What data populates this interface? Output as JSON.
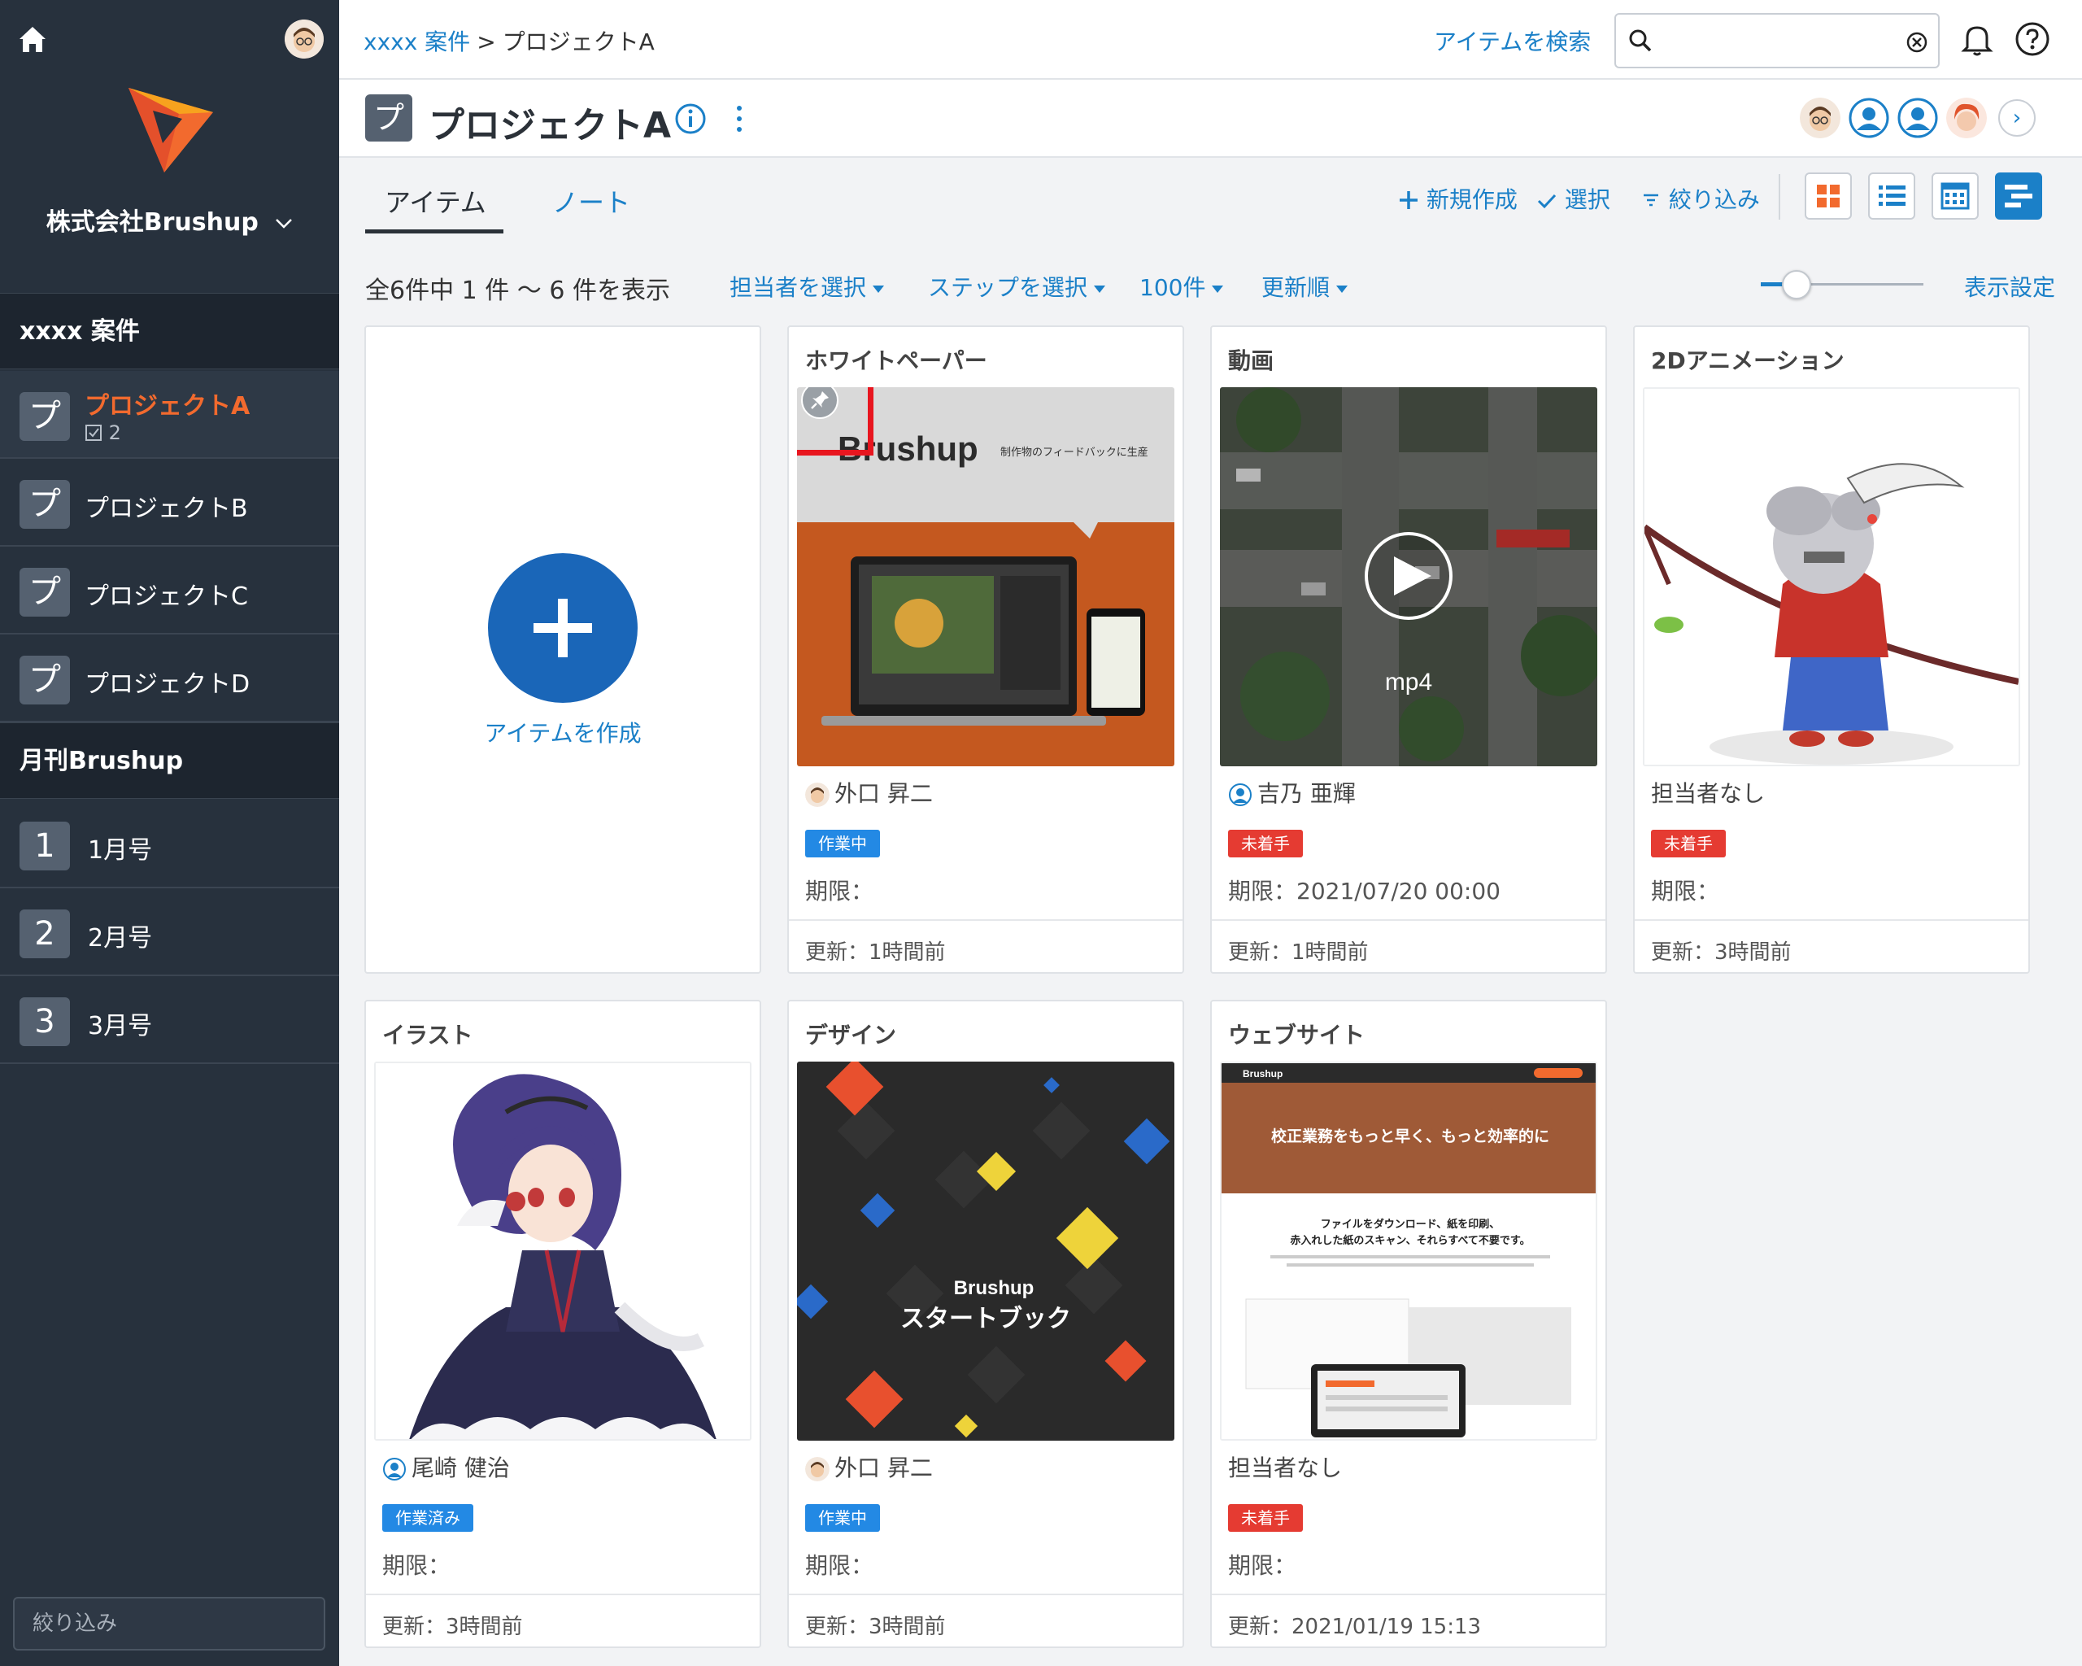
{
  "sidebar": {
    "company": "株式会社Brushup",
    "sections": [
      {
        "title": "xxxx 案件",
        "items": [
          {
            "icon": "プ",
            "label": "プロジェクトA",
            "badge": "2",
            "active": true
          },
          {
            "icon": "プ",
            "label": "プロジェクトB"
          },
          {
            "icon": "プ",
            "label": "プロジェクトC"
          },
          {
            "icon": "プ",
            "label": "プロジェクトD"
          }
        ]
      },
      {
        "title": "月刊Brushup",
        "items": [
          {
            "icon": "1",
            "label": "1月号"
          },
          {
            "icon": "2",
            "label": "2月号"
          },
          {
            "icon": "3",
            "label": "3月号"
          }
        ]
      }
    ],
    "filter_placeholder": "絞り込み"
  },
  "topbar": {
    "breadcrumb": {
      "parent": "xxxx 案件",
      "separator": ">",
      "current": "プロジェクトA"
    },
    "search_link": "アイテムを検索",
    "search_value": ""
  },
  "project": {
    "icon": "プ",
    "title": "プロジェクトA"
  },
  "tabs": [
    "アイテム",
    "ノート"
  ],
  "toolbar": {
    "new": "新規作成",
    "select": "選択",
    "filter": "絞り込み"
  },
  "views": [
    "grid-view",
    "list-view",
    "calendar-view",
    "gantt-view"
  ],
  "filter_row": {
    "count_text": "全6件中 1 件 〜 6 件を表示",
    "assignee": "担当者を選択",
    "step": "ステップを選択",
    "per_page": "100件",
    "sort": "更新順",
    "thumbnail_size_fraction": 0.22,
    "settings": "表示設定"
  },
  "create_card": {
    "label": "アイテムを作成"
  },
  "cards": [
    {
      "title": "ホワイトペーパー",
      "assignee": "外口 昇二",
      "status": "作業中",
      "status_color": "blue",
      "due": "期限：",
      "updated": "更新：1時間前",
      "thumb_text": "Brushup",
      "thumb_sub": "制作物のフィードバックに生産"
    },
    {
      "title": "動画",
      "assignee": "吉乃 亜輝",
      "status": "未着手",
      "status_color": "red",
      "due": "期限：2021/07/20 00:00",
      "updated": "更新：1時間前",
      "thumb_text": "mp4"
    },
    {
      "title": "2Dアニメーション",
      "assignee": "担当者なし",
      "status": "未着手",
      "status_color": "red",
      "due": "期限：",
      "updated": "更新：3時間前"
    },
    {
      "title": "イラスト",
      "assignee": "尾崎 健治",
      "status": "作業済み",
      "status_color": "blue",
      "due": "期限：",
      "updated": "更新：3時間前"
    },
    {
      "title": "デザイン",
      "assignee": "外口 昇二",
      "status": "作業中",
      "status_color": "blue",
      "due": "期限：",
      "updated": "更新：3時間前",
      "thumb_text": "Brushup",
      "thumb_sub": "スタートブック"
    },
    {
      "title": "ウェブサイト",
      "assignee": "担当者なし",
      "status": "未着手",
      "status_color": "red",
      "due": "期限：",
      "updated": "更新：2021/01/19 15:13",
      "thumb_text": "校正業務をもっと早く、もっと効率的に",
      "thumb_sub": "ファイルをダウンロード、紙を印刷、",
      "thumb_sub2": "赤入れした紙のスキャン、それらすべて不要です。",
      "thumb_brand": "Brushup"
    }
  ],
  "colors": {
    "accent": "#1b80c8",
    "sidebar_bg": "#27313d",
    "brand_orange": "#f26a2e",
    "status_blue": "#2389e4",
    "status_red": "#e53b32",
    "highlight": "#e8161f"
  }
}
